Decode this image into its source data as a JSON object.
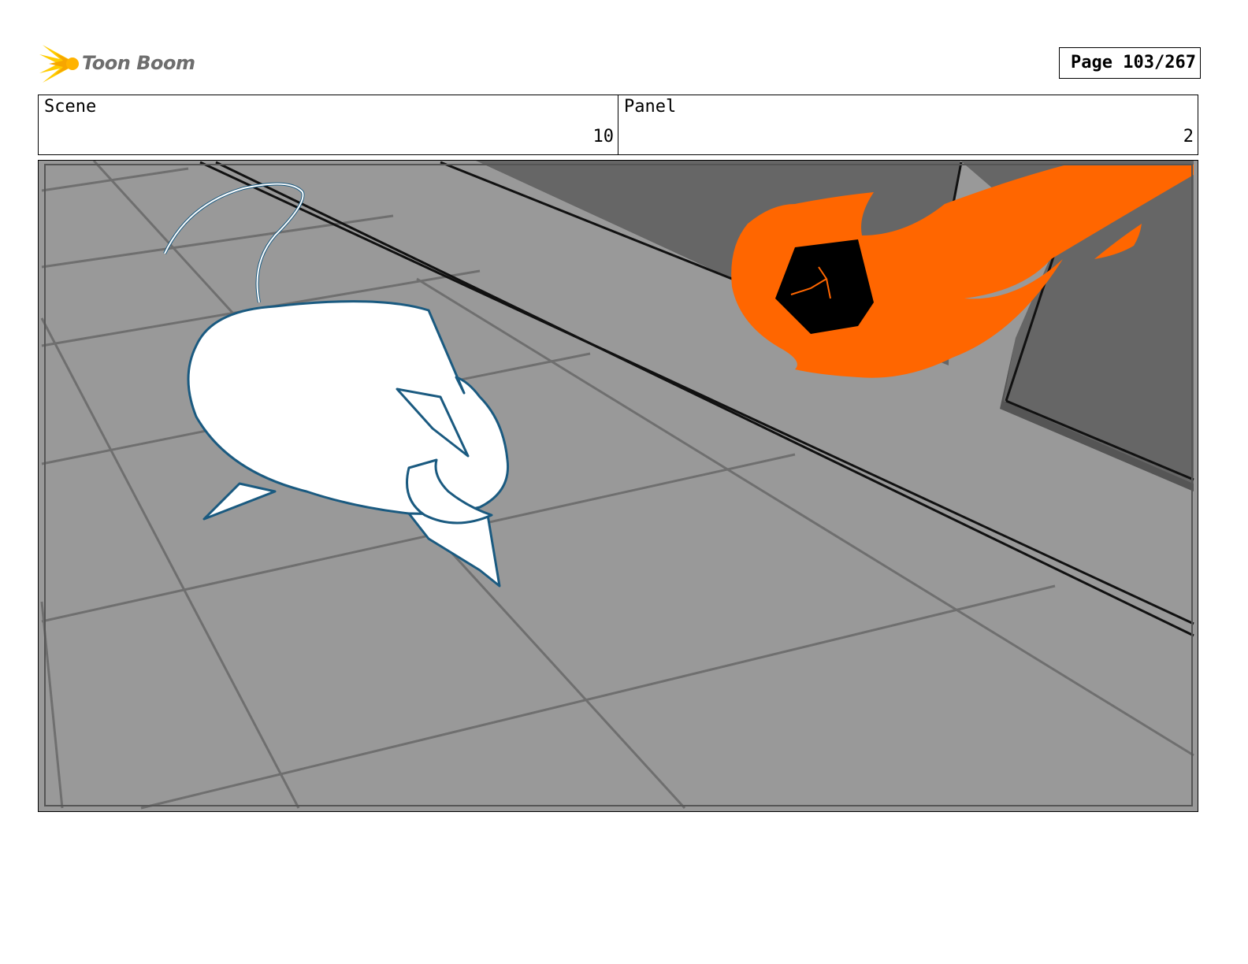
{
  "header": {
    "logo_text": "Toon Boom",
    "page_label": "Page 103/267"
  },
  "info": {
    "scene_label": "Scene",
    "scene_value": "10",
    "panel_label": "Panel",
    "panel_value": "2"
  },
  "colors": {
    "floor": "#999999",
    "wall": "#666666",
    "fireball": "#ff6600",
    "creature_outline": "#1a5a80",
    "logo_accent": "#ffcc00"
  }
}
